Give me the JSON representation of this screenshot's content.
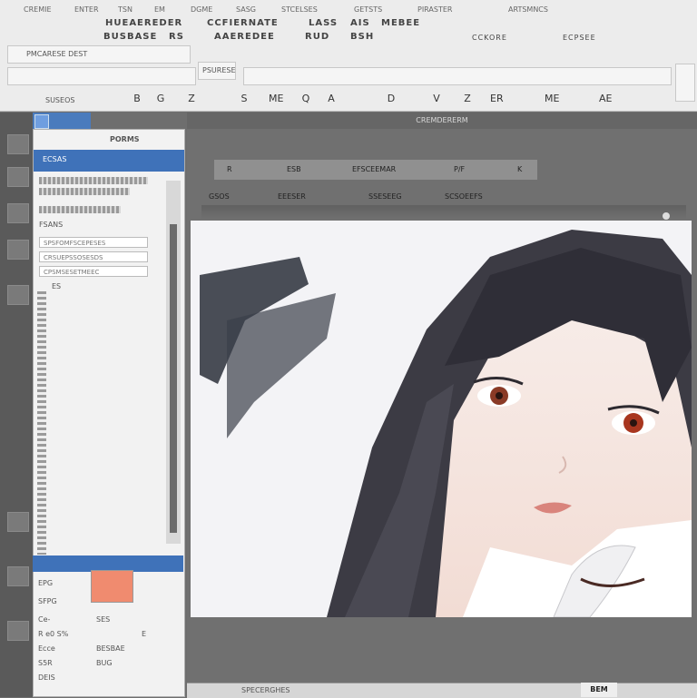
{
  "menu": [
    "CREMIE",
    "ENTER",
    "TSN",
    "EM",
    "DGME",
    "SASG",
    "STCELSES",
    "GETSTS",
    "PIRASTER",
    "ARTSMNCS"
  ],
  "ribbon": {
    "row1": [
      "HUEAEREDER",
      "CCFIERNATE",
      "LASS",
      "AIS",
      "MEBEE"
    ],
    "row2": [
      "BUSBASE",
      "RS",
      "AAEREDEE",
      "RUD",
      "BSH",
      "CCKORE",
      "ECPSEE"
    ],
    "field_a": "PMCARESE DEST",
    "field_b": "PSURESE",
    "tools_label": "SUSEOS",
    "tools": [
      "B",
      "G",
      "Z",
      "S",
      "ME",
      "Q",
      "A",
      "D",
      "V",
      "Z",
      "ER",
      "ME",
      "AE"
    ]
  },
  "panel": {
    "tab_label": "PORMS",
    "header": "ECSAS",
    "section1": "FSANS",
    "fields": [
      "SPSFOMFSCEPESES",
      "CRSUEPSSOSESDS",
      "CPSMSESETMEEC"
    ],
    "section2": "ES",
    "bottom_rows": [
      {
        "label": "EPG",
        "value": ""
      },
      {
        "label": "SFPG",
        "value": ""
      },
      {
        "label": "Ce-",
        "value": "SES"
      },
      {
        "label": "R e0 S%",
        "value": "E"
      },
      {
        "label": "Ecce",
        "value": "BESBAE"
      },
      {
        "label": "S5R",
        "value": "BUG"
      },
      {
        "label": "DEIS",
        "value": ""
      }
    ],
    "swatch_color": "#f08b6f"
  },
  "canvas": {
    "title": "CREMDERERM",
    "bar_items": [
      "R",
      "ESB",
      "EFSCEEMAR",
      "P/F",
      "K"
    ],
    "sub_items": [
      "GSOS",
      "EEESER",
      "SSESEEG",
      "SCSOEEFS"
    ]
  },
  "statusbar": {
    "text": "SPECERGHES",
    "right": "BEM"
  },
  "colors": {
    "accent": "#3f72b9",
    "ribbon_bg": "#ececec",
    "workspace": "#707070"
  }
}
